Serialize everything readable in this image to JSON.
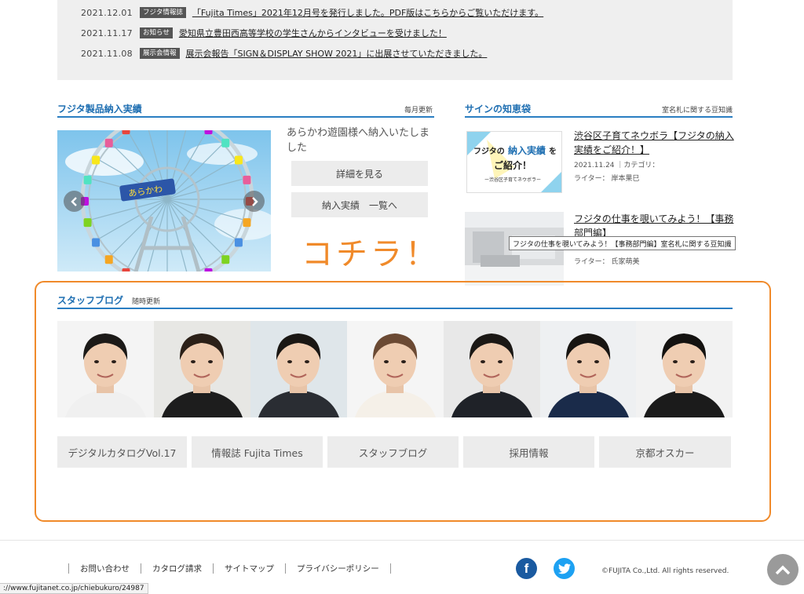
{
  "news": [
    {
      "date": "2021.12.01",
      "badge": "フジタ情報誌",
      "title": "「Fujita Times」2021年12月号を発行しました。PDF版はこちらからご覧いただけます。"
    },
    {
      "date": "2021.11.17",
      "badge": "お知らせ",
      "title": "愛知県立豊田西高等学校の学生さんからインタビューを受けました！"
    },
    {
      "date": "2021.11.08",
      "badge": "展示会情報",
      "title": "展示会報告「SIGN＆DISPLAY SHOW 2021」に出展させていただきました。"
    }
  ],
  "products": {
    "heading": "フジタ製品納入実績",
    "note": "毎月更新",
    "title": "あらかわ遊園様へ納入いたしました",
    "detail_button": "詳細を見る",
    "list_button": "納入実績　一覧へ",
    "kochira": "コチラ！",
    "prev_icon": "chevron-left-icon",
    "next_icon": "chevron-right-icon"
  },
  "knowledge": {
    "heading": "サインの知恵袋",
    "note": "室名札に関する豆知識",
    "articles": [
      {
        "title": "渋谷区子育てネウボラ【フジタの納入実績をご紹介！】",
        "date_category": "2021.11.24 ｜カテゴリ：",
        "writer": "ライター： 岸本果巳",
        "thumb": {
          "line1": "フジタの",
          "accent": "納入実績",
          "line1b": "を",
          "line2": "ご紹介！",
          "sub": "ー渋谷区子育てネウボラー"
        }
      },
      {
        "title": "フジタの仕事を覗いてみよう！【事務部門編】",
        "writer": "ライター： 氏家萌美"
      }
    ],
    "tooltip": "フジタの仕事を覗いてみよう！【事務部門編】室名札に関する豆知識"
  },
  "staff_blog": {
    "heading": "スタッフブログ",
    "note": "随時更新"
  },
  "links": [
    "デジタルカタログVol.17",
    "情報誌 Fujita Times",
    "スタッフブログ",
    "採用情報",
    "京都オスカー"
  ],
  "footer": {
    "links": [
      "お問い合わせ",
      "カタログ請求",
      "サイトマップ",
      "プライバシーポリシー"
    ],
    "facebook": "f",
    "copyright": "©FUJITA Co.,Ltd. All rights reserved.",
    "status_url": "://www.fujitanet.co.jp/chiebukuro/24987"
  },
  "colors": {
    "accent_blue": "#1f6fb2",
    "highlight_orange": "#f08a2a",
    "facebook": "#1a5aa0",
    "twitter": "#1da1f2"
  }
}
